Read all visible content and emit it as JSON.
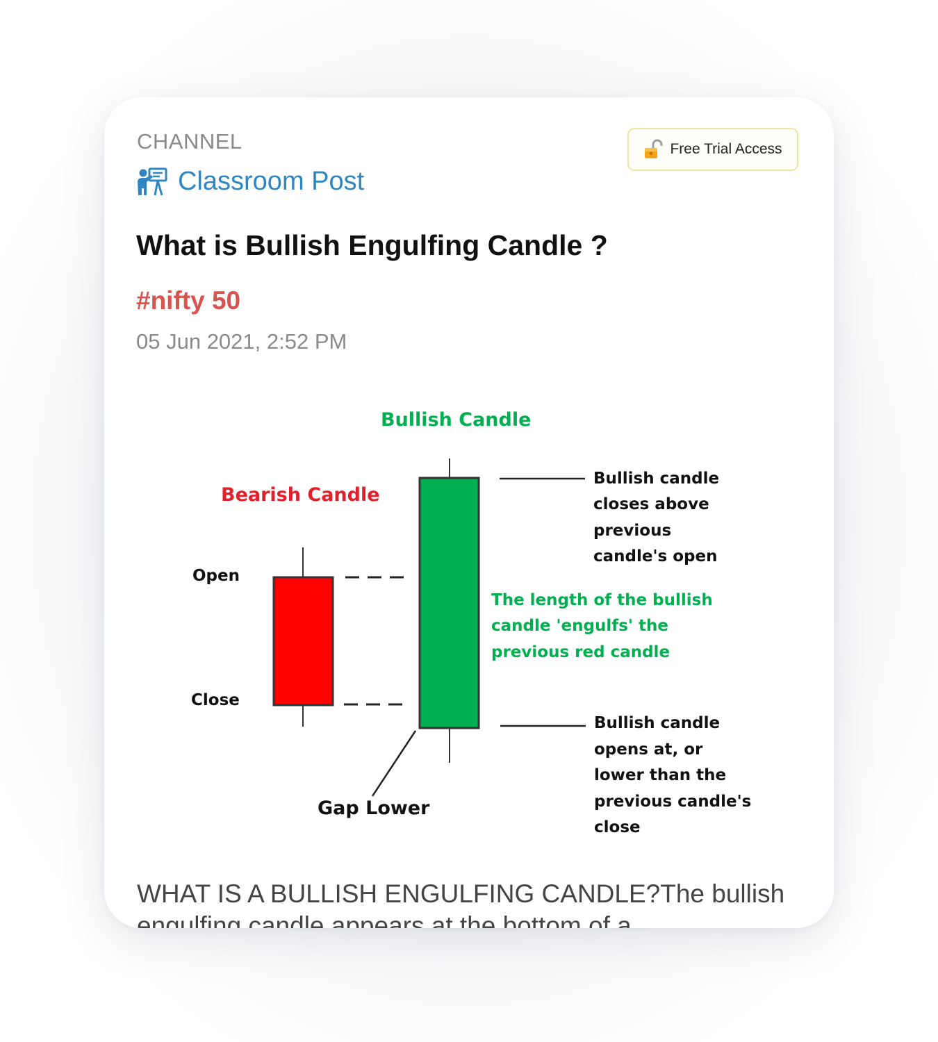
{
  "channel": {
    "label": "CHANNEL",
    "name": "Classroom Post",
    "icon": "classroom-teacher-icon"
  },
  "trial_button": {
    "label": "Free Trial Access",
    "icon": "unlocked-padlock-icon"
  },
  "post": {
    "title": "What is Bullish Engulfing Candle ?",
    "hashtag": "#nifty 50",
    "timestamp": "05 Jun 2021, 2:52 PM",
    "body": "WHAT IS A BULLISH ENGULFING CANDLE?The bullish engulfing candle appears at the bottom of a"
  },
  "diagram": {
    "bullish_title": "Bullish Candle",
    "bearish_title": "Bearish Candle",
    "open_label": "Open",
    "close_label": "Close",
    "gap_label": "Gap Lower",
    "top_note": [
      "Bullish candle",
      "closes above",
      "previous",
      "candle's open"
    ],
    "middle_note": [
      "The length of the bullish",
      "candle 'engulfs' the",
      "previous red candle"
    ],
    "bottom_note": [
      "Bullish candle",
      "opens at, or",
      "lower than the",
      "previous candle's",
      "close"
    ]
  },
  "colors": {
    "accent": "#2f86c2",
    "hashtag": "#d9534f",
    "bearish": "#ff0000",
    "bullish": "#00b050",
    "bullish_text": "#00b050",
    "bearish_text": "#e0202a",
    "trial_border": "#f3e3a0"
  }
}
